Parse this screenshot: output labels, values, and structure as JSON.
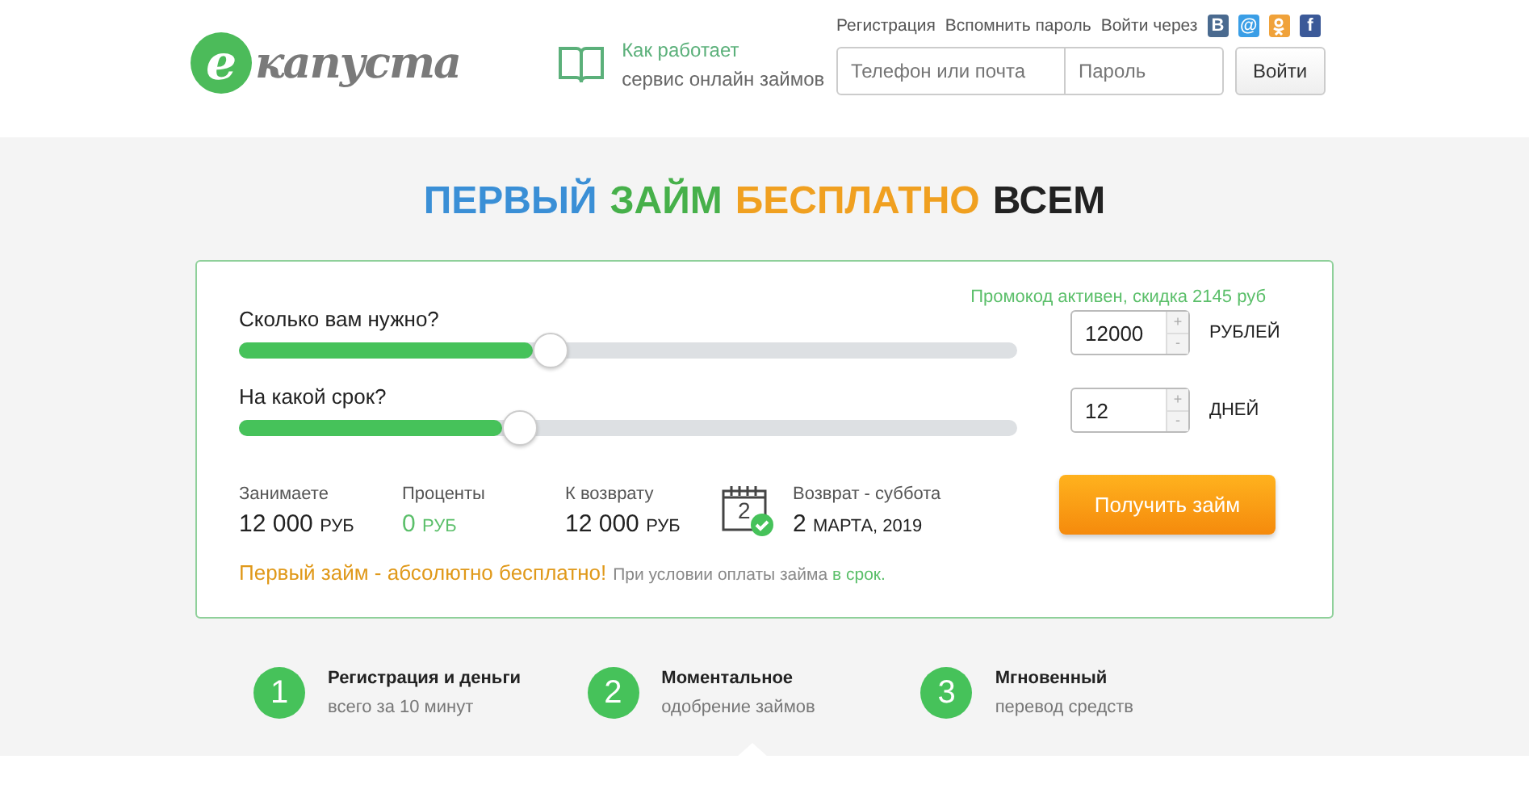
{
  "logo": {
    "letter": "е",
    "name": "капуста"
  },
  "how_it_works": {
    "title": "Как работает",
    "subtitle": "сервис онлайн займов"
  },
  "top_links": [
    "Регистрация",
    "Вспомнить пароль"
  ],
  "social": {
    "label": "Войти через",
    "items": [
      {
        "kind": "letter",
        "label": "В",
        "color": "#4a6a8f"
      },
      {
        "kind": "letter",
        "label": "@",
        "color": "#3a9ee6"
      },
      {
        "kind": "ok",
        "color": "#f0a23a"
      },
      {
        "kind": "letter",
        "label": "f",
        "color": "#3b5998"
      }
    ]
  },
  "login": {
    "phone_placeholder": "Телефон или почта",
    "password_placeholder": "Пароль",
    "button": "Войти"
  },
  "headline": [
    {
      "text": "ПЕРВЫЙ",
      "color": "#3a8fd6"
    },
    {
      "text": "ЗАЙМ",
      "color": "#46b04a"
    },
    {
      "text": "БЕСПЛАТНО",
      "color": "#f0a020"
    },
    {
      "text": "ВСЕМ",
      "color": "#222222"
    }
  ],
  "promo": "Промокод активен, скидка 2145 руб",
  "sliders": [
    {
      "label": "Сколько вам нужно?",
      "level": 0.4,
      "value": "12000",
      "unit": "РУБЛЕЙ",
      "plus": "+",
      "minus": "-"
    },
    {
      "label": "На какой срок?",
      "level": 0.36,
      "value": "12",
      "unit": "ДНЕЙ",
      "plus": "+",
      "minus": "-"
    }
  ],
  "summary": [
    {
      "label": "Занимаете",
      "value": "12 000",
      "unit": "РУБ",
      "color": "#222222"
    },
    {
      "label": "Проценты",
      "value": "0",
      "unit": "РУБ",
      "color": "#5bbf6a"
    },
    {
      "label": "К возврату",
      "value": "12 000",
      "unit": "РУБ",
      "color": "#222222"
    }
  ],
  "return_date": {
    "day": "2",
    "label": "Возврат - суббота",
    "value": "2",
    "unit": "МАРТА, 2019"
  },
  "submit": "Получить займ",
  "note": {
    "title": "Первый займ - абсолютно бесплатно!",
    "text": "При условии оплаты займа",
    "link": "в срок."
  },
  "steps": [
    {
      "number": "1",
      "title": "Регистрация и деньги",
      "subtitle": "всего за 10 минут"
    },
    {
      "number": "2",
      "title": "Моментальное",
      "subtitle": "одобрение займов"
    },
    {
      "number": "3",
      "title": "Мгновенный",
      "subtitle": "перевод средств"
    }
  ]
}
